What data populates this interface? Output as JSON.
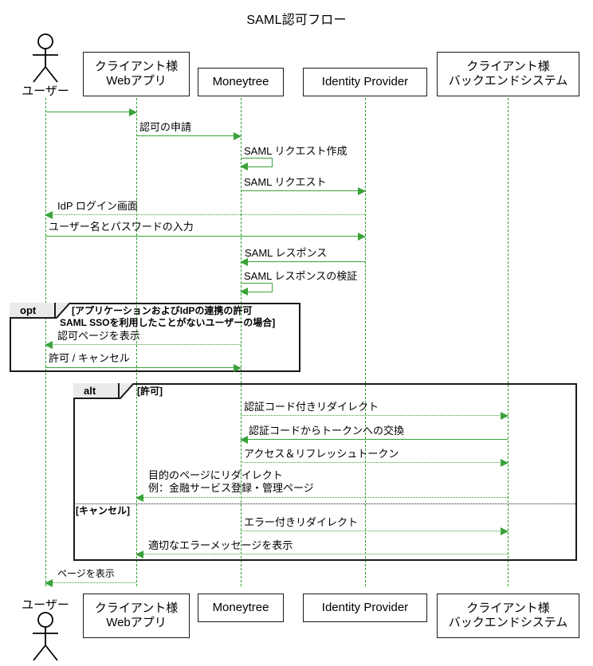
{
  "diagram": {
    "type": "uml-sequence-diagram",
    "title": "SAML認可フロー",
    "colors": {
      "message": "#3aa23a",
      "lifeline": "#2ea02e",
      "border": "#1a1a1a",
      "fragment_tab_fill": "#eaeaea",
      "background": "#ffffff"
    }
  },
  "participants": [
    {
      "name": "ユーザー",
      "kind": "actor"
    },
    {
      "name": "クライアント様\nWebアプリ",
      "line1": "クライアント様",
      "line2": "Webアプリ",
      "kind": "box"
    },
    {
      "name": "Moneytree",
      "line1": "Moneytree",
      "line2": "",
      "kind": "box"
    },
    {
      "name": "Identity Provider",
      "line1": "Identity Provider",
      "line2": "",
      "kind": "box"
    },
    {
      "name": "クライアント様\nバックエンドシステム",
      "line1": "クライアント様",
      "line2": "バックエンドシステム",
      "kind": "box"
    }
  ],
  "messages": [
    {
      "id": "m0",
      "label": "",
      "from": "ユーザー",
      "to": "クライアント様Webアプリ",
      "style": "solid",
      "dir": "right"
    },
    {
      "id": "m1",
      "label": "認可の申請",
      "from": "クライアント様Webアプリ",
      "to": "Moneytree",
      "style": "solid",
      "dir": "right"
    },
    {
      "id": "m2",
      "label": "SAML リクエスト作成",
      "from": "Moneytree",
      "to": "Moneytree",
      "style": "solid",
      "dir": "self"
    },
    {
      "id": "m3",
      "label": "SAML リクエスト",
      "from": "Moneytree",
      "to": "Identity Provider",
      "style": "solid",
      "dir": "right"
    },
    {
      "id": "m4",
      "label": "IdP ログイン画面",
      "from": "Identity Provider",
      "to": "ユーザー",
      "style": "dotted",
      "dir": "left"
    },
    {
      "id": "m5",
      "label": "ユーザー名とパスワードの入力",
      "from": "ユーザー",
      "to": "Identity Provider",
      "style": "solid",
      "dir": "right"
    },
    {
      "id": "m6",
      "label": "SAML レスポンス",
      "from": "Identity Provider",
      "to": "Moneytree",
      "style": "solid",
      "dir": "left"
    },
    {
      "id": "m7",
      "label": "SAML レスポンスの検証",
      "from": "Moneytree",
      "to": "Moneytree",
      "style": "solid",
      "dir": "self"
    },
    {
      "id": "m8",
      "label": "認可ページを表示",
      "from": "Moneytree",
      "to": "ユーザー",
      "style": "dotted",
      "dir": "left"
    },
    {
      "id": "m9",
      "label": "許可 / キャンセル",
      "from": "ユーザー",
      "to": "Moneytree",
      "style": "solid",
      "dir": "right"
    },
    {
      "id": "m10",
      "label": "認証コード付きリダイレクト",
      "from": "Moneytree",
      "to": "クライアント様バックエンドシステム",
      "style": "dotted",
      "dir": "right"
    },
    {
      "id": "m11",
      "label": "認証コードからトークンへの交換",
      "from": "クライアント様バックエンドシステム",
      "to": "Moneytree",
      "style": "solid",
      "dir": "left"
    },
    {
      "id": "m12",
      "label": "アクセス＆リフレッシュトークン",
      "from": "Moneytree",
      "to": "クライアント様バックエンドシステム",
      "style": "dotted",
      "dir": "right"
    },
    {
      "id": "m13",
      "label": "目的のページにリダイレクト\n例：金融サービス登録・管理ページ",
      "from": "クライアント様バックエンドシステム",
      "to": "クライアント様Webアプリ",
      "style": "dotted",
      "dir": "left"
    },
    {
      "id": "m14",
      "label": "エラー付きリダイレクト",
      "from": "Moneytree",
      "to": "クライアント様バックエンドシステム",
      "style": "dotted",
      "dir": "right"
    },
    {
      "id": "m15",
      "label": "適切なエラーメッセージを表示",
      "from": "クライアント様バックエンドシステム",
      "to": "クライアント様Webアプリ",
      "style": "dotted",
      "dir": "left"
    },
    {
      "id": "m16",
      "label": "ページを表示",
      "from": "クライアント様Webアプリ",
      "to": "ユーザー",
      "style": "dotted",
      "dir": "left"
    }
  ],
  "fragments": [
    {
      "id": "opt-block",
      "operator": "opt",
      "condition": "[アプリケーションおよびIdPの連携の許可\n SAML SSOを利用したことがないユーザーの場合]",
      "condition_line1": "[アプリケーションおよびIdPの連携の許可",
      "condition_line2": "SAML SSOを利用したことがないユーザーの場合]"
    },
    {
      "id": "alt-block",
      "operator": "alt",
      "condition": "[許可]",
      "else_condition": "[キャンセル]"
    }
  ]
}
